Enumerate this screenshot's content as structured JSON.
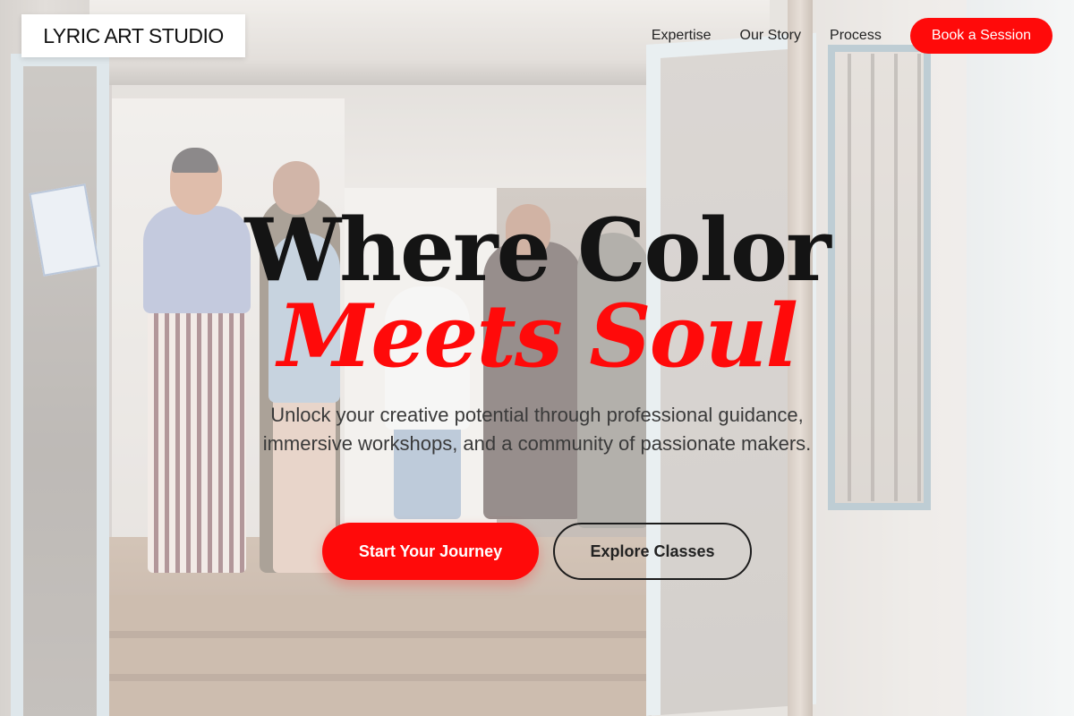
{
  "brand": {
    "name": "LYRIC ART STUDIO"
  },
  "nav": {
    "items": [
      {
        "label": "Expertise"
      },
      {
        "label": "Our Story"
      },
      {
        "label": "Process"
      }
    ],
    "cta_label": "Book a Session"
  },
  "hero": {
    "headline_line1": "Where Color",
    "headline_line2": "Meets Soul",
    "subtitle": "Unlock your creative potential through professional guidance, immersive workshops, and a community of passionate makers.",
    "primary_cta": "Start Your Journey",
    "secondary_cta": "Explore Classes"
  },
  "colors": {
    "accent": "#ff0a0a",
    "text_dark": "#141414",
    "overlay": "rgba(255,255,255,0.42)"
  }
}
